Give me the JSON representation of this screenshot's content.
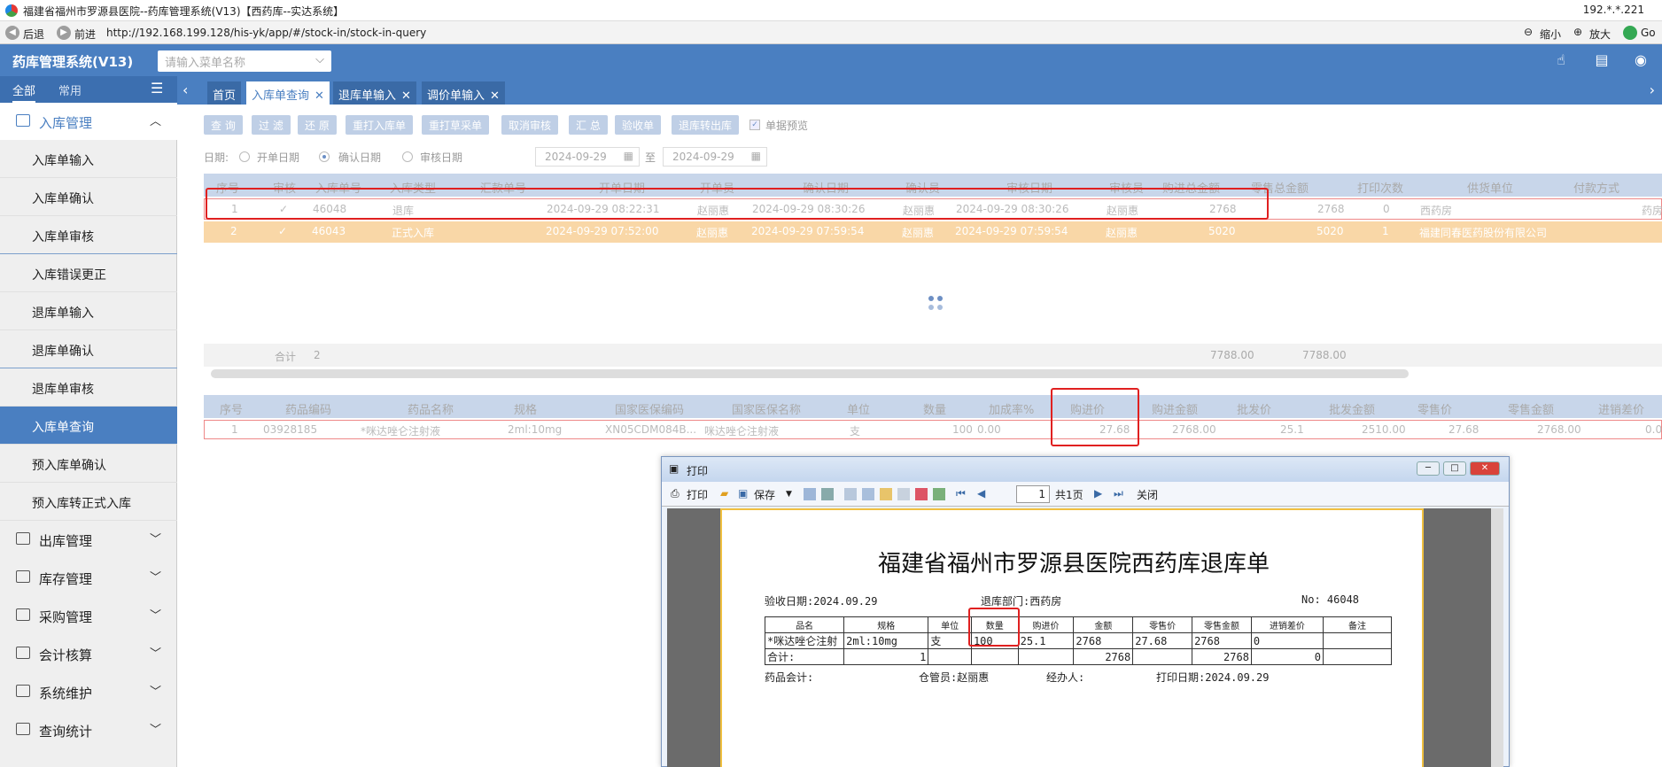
{
  "window": {
    "title": "福建省福州市罗源县医院--药库管理系统(V13)【西药库--实达系统】",
    "ip": "192.*.*.221"
  },
  "browser": {
    "back": "后退",
    "forward": "前进",
    "url": "http://192.168.199.128/his-yk/app/#/stock-in/stock-in-query",
    "zoom_out": "缩小",
    "zoom_in": "放大",
    "go": "Go"
  },
  "header": {
    "system_title": "药库管理系统(V13)",
    "menu_search_placeholder": "请输入菜单名称"
  },
  "sidebar": {
    "tabs": [
      "全部",
      "常用"
    ],
    "groups": [
      {
        "label": "入库管理",
        "expanded": true,
        "items": [
          "入库单输入",
          "入库单确认",
          "入库单审核",
          "入库错误更正",
          "退库单输入",
          "退库单确认",
          "退库单审核",
          "入库单查询",
          "预入库单确认",
          "预入库转正式入库"
        ]
      },
      {
        "label": "出库管理"
      },
      {
        "label": "库存管理"
      },
      {
        "label": "采购管理"
      },
      {
        "label": "会计核算"
      },
      {
        "label": "系统维护"
      },
      {
        "label": "查询统计"
      }
    ],
    "selected": "入库单查询"
  },
  "tabs": [
    {
      "label": "首页"
    },
    {
      "label": "入库单查询",
      "active": true
    },
    {
      "label": "退库单输入"
    },
    {
      "label": "调价单输入"
    }
  ],
  "toolbar": {
    "buttons": [
      "查 询",
      "过 滤",
      "还 原",
      "重打入库单",
      "重打草采单",
      "取消审核",
      "汇 总",
      "验收单",
      "退库转出库"
    ],
    "preview_label": "单据预览"
  },
  "date_filter": {
    "label": "日期:",
    "options": [
      "开单日期",
      "确认日期",
      "审核日期"
    ],
    "selected": "确认日期",
    "from": "2024-09-29",
    "to_label": "至",
    "to": "2024-09-29"
  },
  "master_table": {
    "columns": [
      "序号",
      "审核",
      "入库单号",
      "入库类型",
      "汇款单号",
      "开单日期",
      "开单员",
      "确认日期",
      "确认员",
      "审核日期",
      "审核员",
      "购进总金额",
      "零售总金额",
      "打印次数",
      "供货单位",
      "付款方式"
    ],
    "rows": [
      [
        "1",
        "✓",
        "46048",
        "退库",
        "",
        "2024-09-29 08:22:31",
        "赵丽惠",
        "2024-09-29 08:30:26",
        "赵丽惠",
        "2024-09-29 08:30:26",
        "赵丽惠",
        "2768",
        "2768",
        "0",
        "西药房",
        "",
        "药房"
      ],
      [
        "2",
        "✓",
        "46043",
        "正式入库",
        "",
        "2024-09-29 07:52:00",
        "赵丽惠",
        "2024-09-29 07:59:54",
        "赵丽惠",
        "2024-09-29 07:59:54",
        "赵丽惠",
        "5020",
        "5020",
        "1",
        "福建同春医药股份有限公司",
        ""
      ]
    ],
    "footer": {
      "label": "合计",
      "count": "2",
      "total_purchase": "7788.00",
      "total_retail": "7788.00"
    }
  },
  "detail_table": {
    "columns": [
      "序号",
      "药品编码",
      "药品名称",
      "规格",
      "国家医保编码",
      "国家医保名称",
      "单位",
      "数量",
      "加成率%",
      "购进价",
      "购进金额",
      "批发价",
      "批发金额",
      "零售价",
      "零售金额",
      "进销差价"
    ],
    "rows": [
      [
        "1",
        "03928185",
        "*咪达唑仑注射液",
        "2ml:10mg",
        "XN05CDM084B...",
        "咪达唑仑注射液",
        "支",
        "100",
        "0.00",
        "27.68",
        "2768.00",
        "25.1",
        "2510.00",
        "27.68",
        "2768.00",
        "0.0"
      ]
    ]
  },
  "print_window": {
    "title": "打印",
    "toolbar": {
      "print": "打印",
      "save": "保存",
      "page": "1",
      "total": "共1页",
      "close": "关闭"
    },
    "doc": {
      "title": "福建省福州市罗源县医院西药库退库单",
      "receipt_date": "验收日期:2024.09.29",
      "dept": "退库部门:西药房",
      "no": "No: 46048",
      "headers": [
        "品名",
        "规格",
        "单位",
        "数量",
        "购进价",
        "金额",
        "零售价",
        "零售金额",
        "进销差价",
        "备注"
      ],
      "row": [
        "*咪达唑仑注射",
        "2ml:10mg",
        "支",
        "100",
        "25.1",
        "2768",
        "27.68",
        "2768",
        "0",
        ""
      ],
      "total": {
        "label": "合计:",
        "qty": "1",
        "amount": "2768",
        "retail": "2768",
        "diff": "0"
      },
      "sign": {
        "accountant": "药品会计:",
        "keeper": "仓管员:赵丽惠",
        "handler": "经办人:",
        "print_date": "打印日期:2024.09.29"
      }
    }
  },
  "colors": {
    "primary": "#4a7fc1",
    "highlight": "#e02020",
    "row_selected": "#f9d7a7"
  }
}
